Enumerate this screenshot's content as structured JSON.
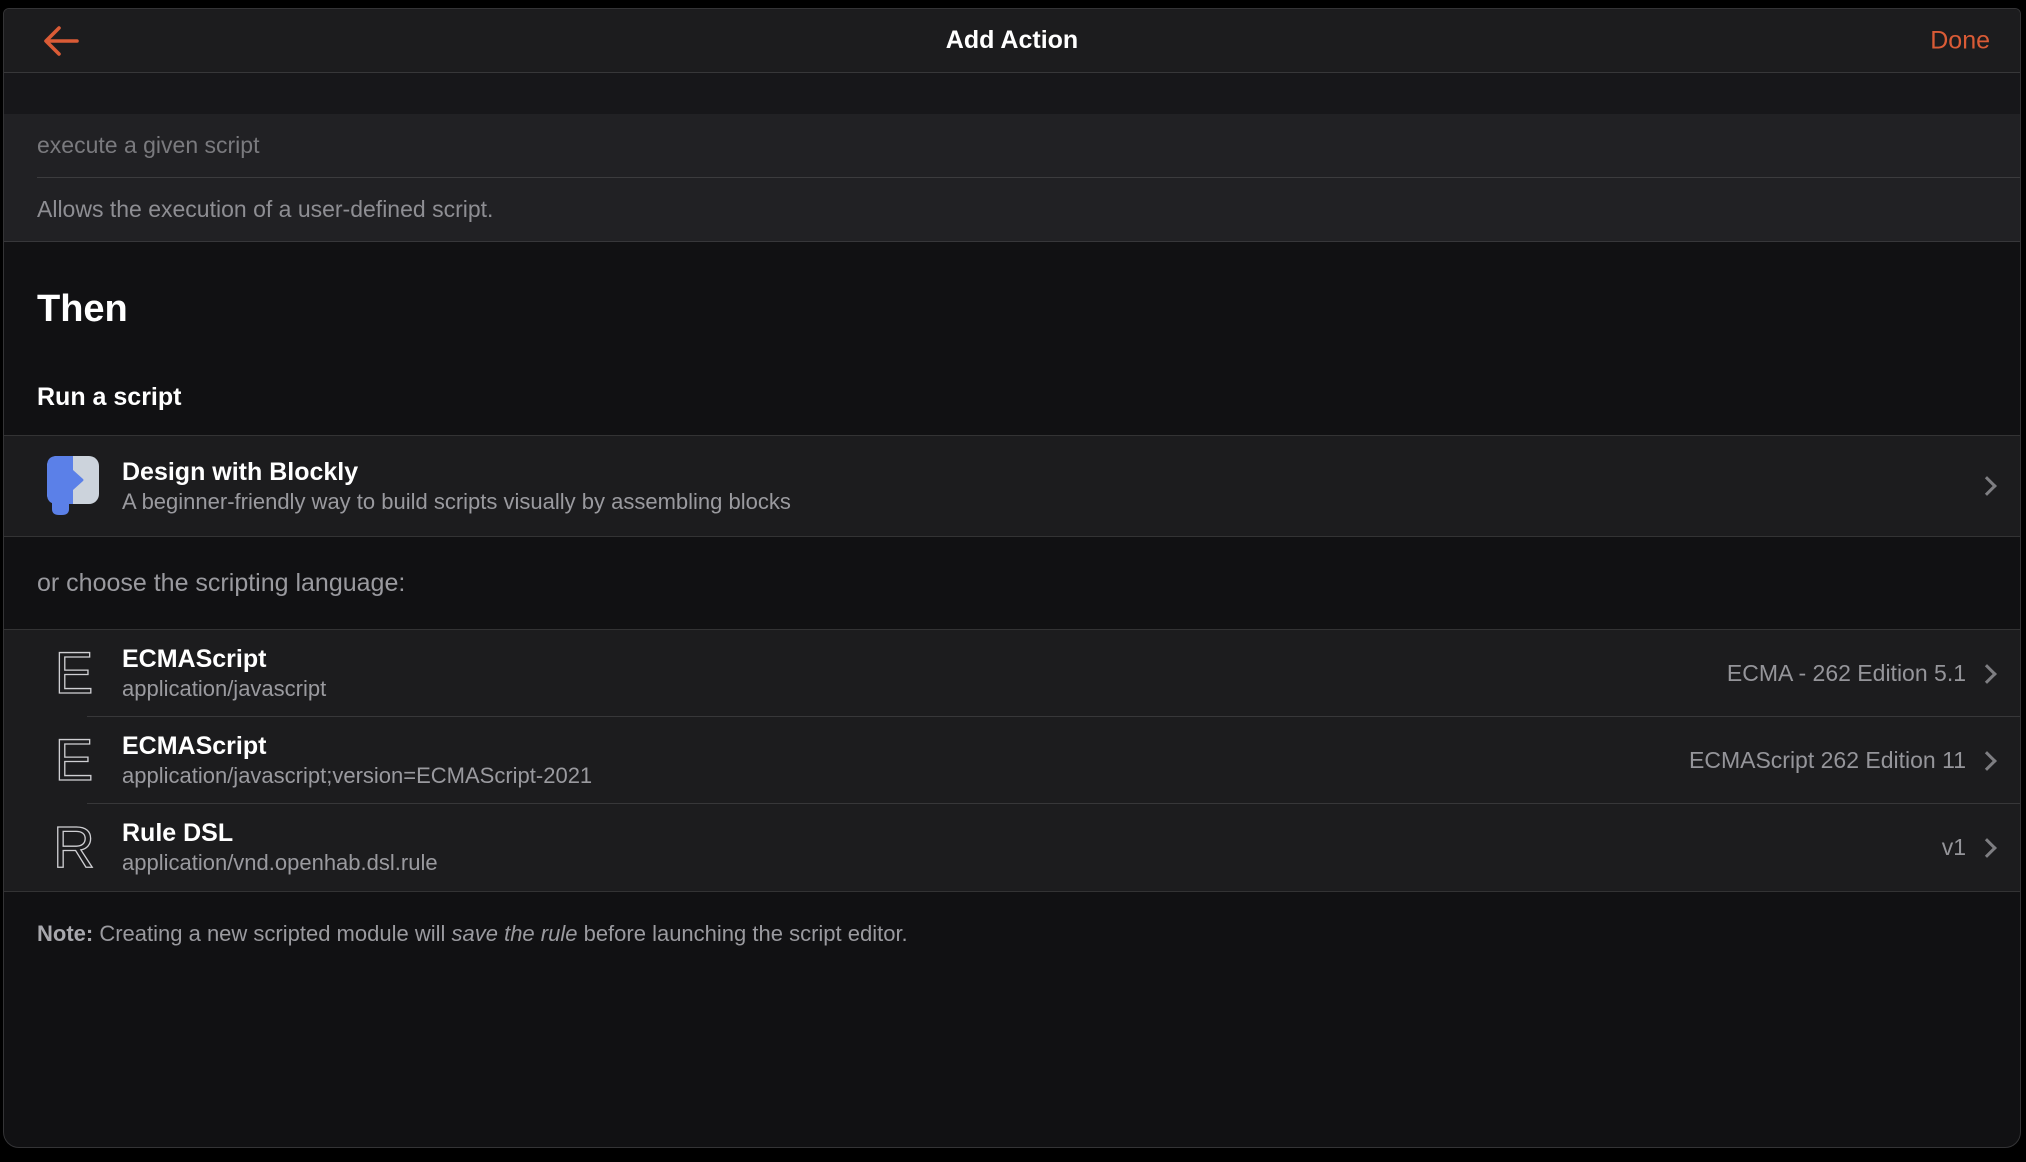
{
  "accent_color": "#da5b36",
  "navbar": {
    "title": "Add Action",
    "done_label": "Done"
  },
  "form": {
    "title_value": "execute a given script",
    "description_value": "Allows the execution of a user-defined script."
  },
  "section": {
    "heading": "Then",
    "subheading": "Run a script"
  },
  "blockly": {
    "title": "Design with Blockly",
    "subtitle": "A beginner-friendly way to build scripts visually by assembling blocks",
    "icon_colors": {
      "blue": "#5b80e8",
      "gray": "#ccd3dc"
    }
  },
  "choose_label": "or choose the scripting language:",
  "languages": [
    {
      "icon_letter": "E",
      "title": "ECMAScript",
      "subtitle": "application/javascript",
      "version": "ECMA - 262 Edition 5.1"
    },
    {
      "icon_letter": "E",
      "title": "ECMAScript",
      "subtitle": "application/javascript;version=ECMAScript-2021",
      "version": "ECMAScript 262 Edition 11"
    },
    {
      "icon_letter": "R",
      "title": "Rule DSL",
      "subtitle": "application/vnd.openhab.dsl.rule",
      "version": "v1"
    }
  ],
  "note": {
    "prefix": "Note:",
    "before_italic": " Creating a new scripted module will ",
    "italic": "save the rule",
    "after_italic": " before launching the script editor."
  }
}
